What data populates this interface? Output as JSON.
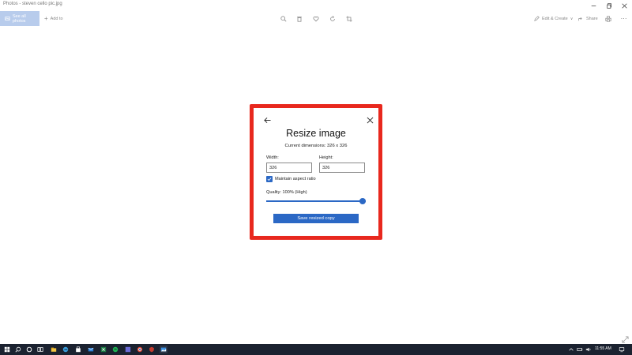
{
  "window": {
    "title": "Photos - steven cello pic.jpg"
  },
  "toolbar": {
    "see_all_label": "See all photos",
    "add_to_label": "Add to",
    "edit_create_label": "Edit & Create",
    "share_label": "Share"
  },
  "dialog": {
    "title": "Resize image",
    "current_dimensions": "Current dimensions: 326 x 326",
    "width_label": "Width:",
    "width_value": "326",
    "height_label": "Height:",
    "height_value": "326",
    "aspect_label": "Maintain aspect ratio",
    "aspect_checked": true,
    "quality_label": "Quality: 100% (High)",
    "quality_fraction": 1.0,
    "save_label": "Save resized copy"
  },
  "taskbar": {
    "time": "11:55 AM"
  },
  "colors": {
    "accent": "#2b68c5",
    "highlight": "#e8281e",
    "taskbar": "#1b2230"
  },
  "icons": [
    "minimize-icon",
    "maximize-icon",
    "close-icon",
    "zoom-icon",
    "delete-icon",
    "heart-icon",
    "rotate-icon",
    "crop-icon",
    "edit-icon",
    "share-icon",
    "print-icon",
    "more-icon",
    "back-arrow-icon",
    "checkmark-icon",
    "expand-icon",
    "windows-start-icon",
    "search-icon",
    "cortana-icon",
    "task-view-icon"
  ]
}
